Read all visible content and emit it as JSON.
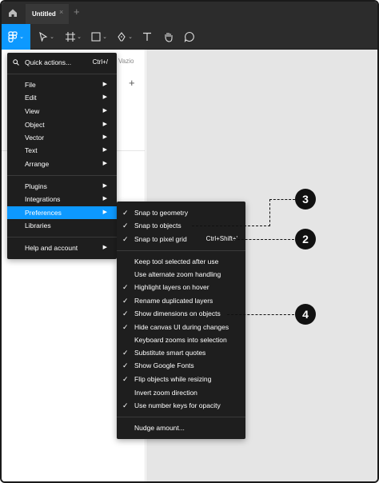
{
  "tabs": {
    "title": "Untitled",
    "close": "×",
    "add": "+"
  },
  "left_panel": {
    "label": "Vazio",
    "plus": "+"
  },
  "main_menu": {
    "quick_actions": {
      "label": "Quick actions...",
      "shortcut": "Ctrl+/"
    },
    "items": [
      "File",
      "Edit",
      "View",
      "Object",
      "Vector",
      "Text",
      "Arrange"
    ],
    "items2": [
      "Plugins",
      "Integrations",
      "Preferences",
      "Libraries"
    ],
    "help": "Help and account"
  },
  "preferences_menu": {
    "group1": [
      {
        "label": "Snap to geometry",
        "checked": true
      },
      {
        "label": "Snap to objects",
        "checked": true
      },
      {
        "label": "Snap to pixel grid",
        "checked": true,
        "shortcut": "Ctrl+Shift+'"
      }
    ],
    "group2": [
      {
        "label": "Keep tool selected after use",
        "checked": false
      },
      {
        "label": "Use alternate zoom handling",
        "checked": false
      },
      {
        "label": "Highlight layers on hover",
        "checked": true
      },
      {
        "label": "Rename duplicated layers",
        "checked": true
      },
      {
        "label": "Show dimensions on objects",
        "checked": true
      },
      {
        "label": "Hide canvas UI during changes",
        "checked": true
      },
      {
        "label": "Keyboard zooms into selection",
        "checked": false
      },
      {
        "label": "Substitute smart quotes",
        "checked": true
      },
      {
        "label": "Show Google Fonts",
        "checked": true
      },
      {
        "label": "Flip objects while resizing",
        "checked": true
      },
      {
        "label": "Invert zoom direction",
        "checked": false
      },
      {
        "label": "Use number keys for opacity",
        "checked": true
      }
    ],
    "nudge": "Nudge amount..."
  },
  "callouts": {
    "c3": "3",
    "c2": "2",
    "c4": "4"
  },
  "colors": {
    "accent": "#0d99ff",
    "menu_bg": "#1e1e1e",
    "toolbar_bg": "#2c2c2c",
    "canvas_bg": "#e5e5e5"
  }
}
